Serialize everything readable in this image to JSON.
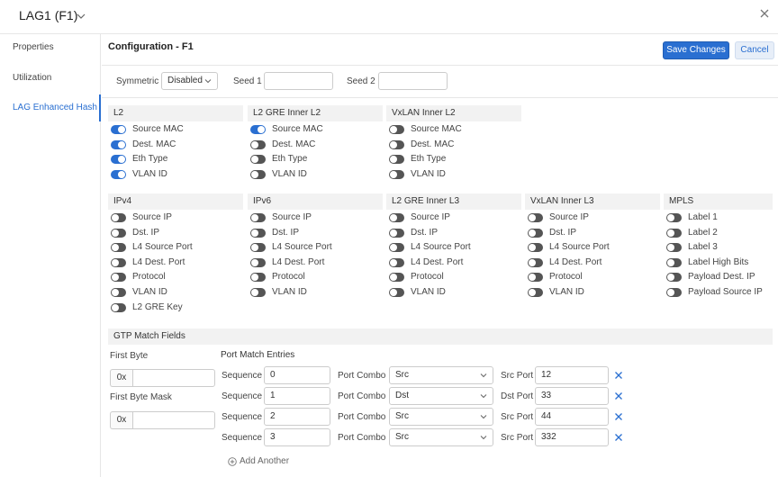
{
  "window": {
    "title": "LAG1 (F1)"
  },
  "sidebar": {
    "items": [
      {
        "label": "Properties"
      },
      {
        "label": "Utilization"
      },
      {
        "label": "LAG Enhanced Hash"
      }
    ]
  },
  "config": {
    "title": "Configuration - F1",
    "save_label": "Save Changes",
    "cancel_label": "Cancel",
    "symmetric_label": "Symmetric",
    "symmetric_value": "Disabled",
    "seed1_label": "Seed 1",
    "seed1_value": "",
    "seed2_label": "Seed 2",
    "seed2_value": ""
  },
  "accent_color": "#2a6fd1",
  "sections": [
    {
      "title": "L2",
      "items": [
        {
          "label": "Source MAC",
          "on": true
        },
        {
          "label": "Dest. MAC",
          "on": true
        },
        {
          "label": "Eth Type",
          "on": true
        },
        {
          "label": "VLAN ID",
          "on": true
        }
      ]
    },
    {
      "title": "L2 GRE Inner L2",
      "items": [
        {
          "label": "Source MAC",
          "on": true
        },
        {
          "label": "Dest. MAC",
          "on": false
        },
        {
          "label": "Eth Type",
          "on": false
        },
        {
          "label": "VLAN ID",
          "on": false
        }
      ]
    },
    {
      "title": "VxLAN Inner L2",
      "items": [
        {
          "label": "Source MAC",
          "on": false
        },
        {
          "label": "Dest. MAC",
          "on": false
        },
        {
          "label": "Eth Type",
          "on": false
        },
        {
          "label": "VLAN ID",
          "on": false
        }
      ]
    },
    {
      "title": "IPv4",
      "items": [
        {
          "label": "Source IP",
          "on": false
        },
        {
          "label": "Dst. IP",
          "on": false
        },
        {
          "label": "L4 Source Port",
          "on": false
        },
        {
          "label": "L4 Dest. Port",
          "on": false
        },
        {
          "label": "Protocol",
          "on": false
        },
        {
          "label": "VLAN ID",
          "on": false
        },
        {
          "label": "L2 GRE Key",
          "on": false
        }
      ]
    },
    {
      "title": "IPv6",
      "items": [
        {
          "label": "Source IP",
          "on": false
        },
        {
          "label": "Dst. IP",
          "on": false
        },
        {
          "label": "L4 Source Port",
          "on": false
        },
        {
          "label": "L4 Dest. Port",
          "on": false
        },
        {
          "label": "Protocol",
          "on": false
        },
        {
          "label": "VLAN ID",
          "on": false
        }
      ]
    },
    {
      "title": "L2 GRE Inner L3",
      "items": [
        {
          "label": "Source IP",
          "on": false
        },
        {
          "label": "Dst. IP",
          "on": false
        },
        {
          "label": "L4 Source Port",
          "on": false
        },
        {
          "label": "L4 Dest. Port",
          "on": false
        },
        {
          "label": "Protocol",
          "on": false
        },
        {
          "label": "VLAN ID",
          "on": false
        }
      ]
    },
    {
      "title": "VxLAN Inner L3",
      "items": [
        {
          "label": "Source IP",
          "on": false
        },
        {
          "label": "Dst. IP",
          "on": false
        },
        {
          "label": "L4 Source Port",
          "on": false
        },
        {
          "label": "L4 Dest. Port",
          "on": false
        },
        {
          "label": "Protocol",
          "on": false
        },
        {
          "label": "VLAN ID",
          "on": false
        }
      ]
    },
    {
      "title": "MPLS",
      "items": [
        {
          "label": "Label 1",
          "on": false
        },
        {
          "label": "Label 2",
          "on": false
        },
        {
          "label": "Label 3",
          "on": false
        },
        {
          "label": "Label High Bits",
          "on": false
        },
        {
          "label": "Payload Dest. IP",
          "on": false
        },
        {
          "label": "Payload Source IP",
          "on": false
        }
      ]
    }
  ],
  "gtp": {
    "title": "GTP Match Fields",
    "first_byte_label": "First Byte",
    "first_byte_mask_label": "First Byte Mask",
    "hex_prefix": "0x",
    "first_byte_value": "",
    "first_byte_mask_value": "",
    "port_match_title": "Port Match Entries",
    "sequence_label": "Sequence",
    "port_combo_label": "Port Combo",
    "add_another_label": "Add Another",
    "entries": [
      {
        "sequence": "0",
        "combo": "Src",
        "port_label": "Src Port",
        "port": "12"
      },
      {
        "sequence": "1",
        "combo": "Dst",
        "port_label": "Dst Port",
        "port": "33"
      },
      {
        "sequence": "2",
        "combo": "Src",
        "port_label": "Src Port",
        "port": "44"
      },
      {
        "sequence": "3",
        "combo": "Src",
        "port_label": "Src Port",
        "port": "332"
      }
    ]
  }
}
